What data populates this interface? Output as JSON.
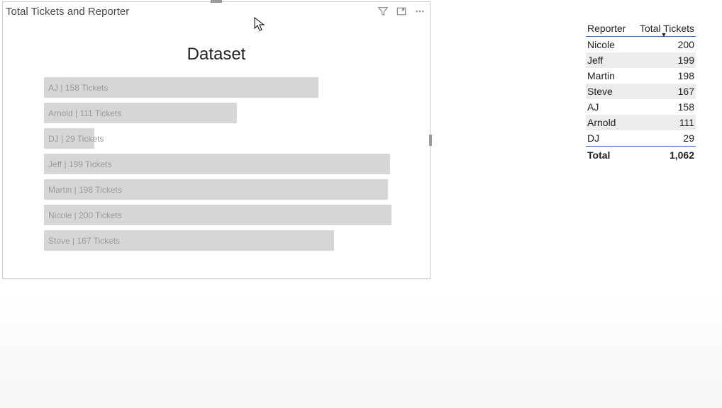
{
  "visual": {
    "title": "Total Tickets and Reporter",
    "chart_title": "Dataset"
  },
  "chart_data": {
    "type": "bar",
    "title": "Dataset",
    "xlabel": "",
    "ylabel": "",
    "series_label_template": "{name} | {value} Tickets",
    "bars": [
      {
        "name": "AJ",
        "value": 158,
        "label": "AJ | 158 Tickets"
      },
      {
        "name": "Arnold",
        "value": 111,
        "label": "Arnold | 111 Tickets"
      },
      {
        "name": "DJ",
        "value": 29,
        "label": "DJ | 29 Tickets"
      },
      {
        "name": "Jeff",
        "value": 199,
        "label": "Jeff | 199 Tickets"
      },
      {
        "name": "Martin",
        "value": 198,
        "label": "Martin | 198 Tickets"
      },
      {
        "name": "Nicole",
        "value": 200,
        "label": "Nicole | 200 Tickets"
      },
      {
        "name": "Steve",
        "value": 167,
        "label": "Steve | 167 Tickets"
      }
    ],
    "max_value": 200
  },
  "table": {
    "headers": {
      "reporter": "Reporter",
      "total": "Total Tickets"
    },
    "sort_column": "total",
    "sort_dir": "desc",
    "rows": [
      {
        "reporter": "Nicole",
        "total": "200"
      },
      {
        "reporter": "Jeff",
        "total": "199"
      },
      {
        "reporter": "Martin",
        "total": "198"
      },
      {
        "reporter": "Steve",
        "total": "167"
      },
      {
        "reporter": "AJ",
        "total": "158"
      },
      {
        "reporter": "Arnold",
        "total": "111"
      },
      {
        "reporter": "DJ",
        "total": "29"
      }
    ],
    "total_label": "Total",
    "total_value": "1,062"
  }
}
